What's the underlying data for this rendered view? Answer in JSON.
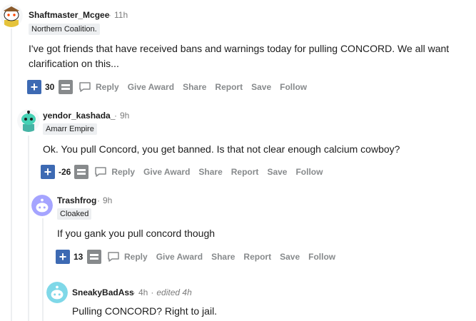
{
  "comments": [
    {
      "username": "Shaftmaster_Mcgee",
      "time": "11h",
      "flair": "Northern Coalition.",
      "body": "I've got friends that have received bans and warnings today for pulling CONCORD. We all want clarification on this...",
      "score": "30"
    },
    {
      "username": "yendor_kashada_",
      "time": "9h",
      "flair": "Amarr Empire",
      "body": "Ok. You pull Concord, you get banned. Is that not clear enough calcium cowboy?",
      "score": "-26"
    },
    {
      "username": "Trashfrog",
      "time": "9h",
      "flair": "Cloaked",
      "body": "If you gank you pull concord though",
      "score": "13"
    },
    {
      "username": "SneakyBadAss",
      "time": "4h",
      "edited": "edited 4h",
      "body": "Pulling CONCORD? Right to jail."
    }
  ],
  "actions": {
    "reply": "Reply",
    "give_award": "Give Award",
    "share": "Share",
    "report": "Report",
    "save": "Save",
    "follow": "Follow"
  },
  "sep": "·"
}
